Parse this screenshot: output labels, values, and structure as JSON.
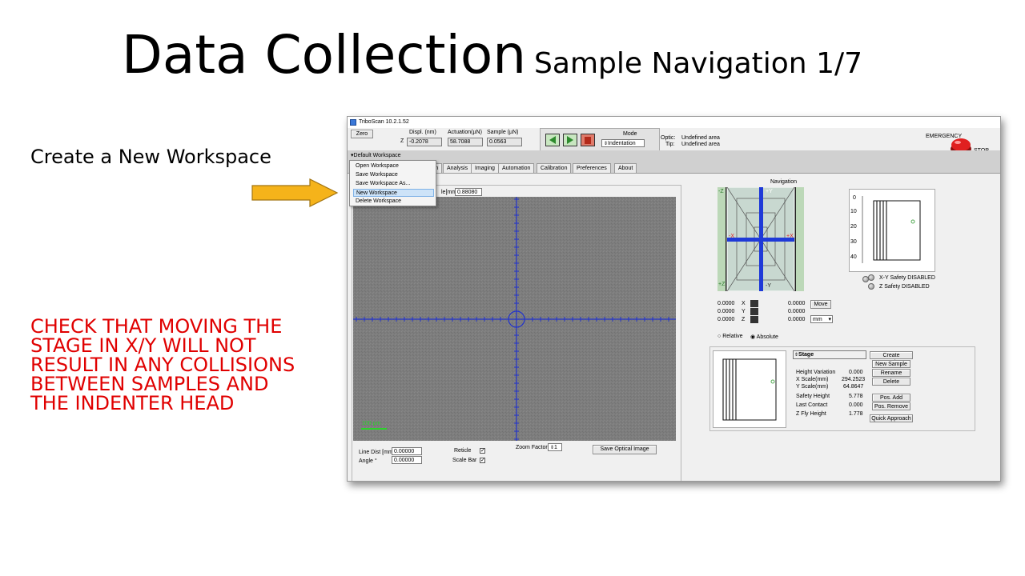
{
  "slide": {
    "title_main": "Data Collection",
    "title_sub": "Sample Navigation 1/7",
    "step_text": "Create a New Workspace",
    "warning_text": "CHECK THAT MOVING THE STAGE IN X/Y WILL NOT RESULT IN ANY COLLISIONS BETWEEN SAMPLES AND THE INDENTER HEAD",
    "colors": {
      "warning": "#e00000",
      "arrow": "#f5b31a"
    }
  },
  "app": {
    "window_title": "TriboScan 10.2.1.52",
    "zero_button": "Zero",
    "readouts": {
      "z_label": "Z",
      "headers": [
        "Displ. (nm)",
        "Actuation(µN)",
        "Sample (µN)"
      ],
      "values": [
        "-0.2078",
        "58.7088",
        "0.0563"
      ]
    },
    "mode": {
      "label": "Mode",
      "value": "Indentation"
    },
    "optic": {
      "label": "Optic:",
      "value": "Undefined area"
    },
    "tip": {
      "label": "Tip:",
      "value": "Undefined area"
    },
    "emergency": {
      "line1": "EMERGENCY",
      "line2": "STOP"
    },
    "workspace": {
      "label": "Default Workspace"
    },
    "menu": {
      "items": [
        "Open Workspace",
        "Save Workspace",
        "Save Workspace As...",
        "New Workspace",
        "Delete Workspace"
      ],
      "selected": "New Workspace"
    },
    "tabs": [
      "ion",
      "Analysis",
      "Imaging",
      "Automation",
      "Calibration",
      "Preferences",
      "About"
    ],
    "camera": {
      "scale_field_label": "le[mm]",
      "scale_field_value": "0.88080",
      "scale_bar_label": "100 µm",
      "line_dist_label": "Line Dist [mm]",
      "line_dist_value": "0.00000",
      "angle_label": "Angle °",
      "angle_value": "0.00000",
      "reticle_label": "Reticle",
      "scale_bar_check_label": "Scale Bar",
      "zoom_label": "Zoom Factor",
      "zoom_value": "1",
      "save_button": "Save Optical Image"
    },
    "navigation": {
      "title": "Navigation",
      "map_labels": [
        "+Y",
        "-Y",
        "-X",
        "+X",
        "-Z",
        "+Z"
      ],
      "y_ticks": [
        "0",
        "10",
        "20",
        "30",
        "40"
      ],
      "xy_safety": "X-Y Safety DISABLED",
      "z_safety": "Z   Safety DISABLED",
      "coords": [
        {
          "current": "0.0000",
          "axis": "X",
          "target": "0.0000"
        },
        {
          "current": "0.0000",
          "axis": "Y",
          "target": "0.0000"
        },
        {
          "current": "0.0000",
          "axis": "Z",
          "target": "0.0000"
        }
      ],
      "move_button": "Move",
      "unit": "mm",
      "relative_label": "Relative",
      "absolute_label": "Absolute",
      "selected_mode": "Absolute"
    },
    "stage": {
      "name": "Stage",
      "rows": [
        {
          "label": "Height Variation",
          "value": "0.000"
        },
        {
          "label": "X Scale(mm)",
          "value": "294.2523"
        },
        {
          "label": "Y Scale(mm)",
          "value": "64.8647"
        },
        {
          "label": "Safety Height",
          "value": "5.778"
        },
        {
          "label": "Last Contact",
          "value": "0.000"
        },
        {
          "label": "Z Fly Height",
          "value": "1.778"
        }
      ],
      "buttons": [
        "Create Boundary",
        "New Sample",
        "Rename",
        "Delete",
        "Pos. Add",
        "Pos. Remove",
        "Quick Approach"
      ]
    }
  }
}
